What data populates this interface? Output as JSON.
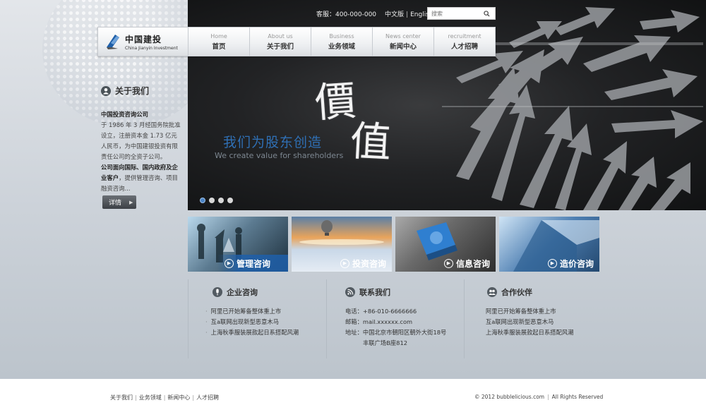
{
  "header": {
    "hotline": "客服：400-000-000",
    "lang_cn": "中文版",
    "lang_en": "English",
    "search_placeholder": "搜索"
  },
  "logo": {
    "cn": "中国建投",
    "en": "China Jianyin Investment"
  },
  "nav": [
    {
      "en": "Home",
      "cn": "首页"
    },
    {
      "en": "About us",
      "cn": "关于我们"
    },
    {
      "en": "Business",
      "cn": "业务领域"
    },
    {
      "en": "News center",
      "cn": "新闻中心"
    },
    {
      "en": "recruitment",
      "cn": "人才招聘"
    }
  ],
  "banner": {
    "cn": "我们为股东创造",
    "en": "We create value for shareholders",
    "calligraphy_1": "價",
    "calligraphy_2": "值",
    "active_slide": 1
  },
  "about": {
    "title": "关于我们",
    "company": "中国投资咨询公司",
    "para1": "于 1986 年 3 月经国务院批准设立，注册资本金 1.73 亿元人民币，为中国建银投资有限责任公司的全资子公司。",
    "bold2": "公司面向国际、国内政府及企业客户",
    "para2": "，提供管理咨询、项目融资咨询...",
    "detail_label": "详情"
  },
  "services": [
    {
      "label": "管理咨询"
    },
    {
      "label": "投资咨询"
    },
    {
      "label": "信息咨询"
    },
    {
      "label": "造价咨询"
    }
  ],
  "columns": {
    "enterprise": {
      "title": "企业咨询",
      "items": [
        "阿里已开始筹备整体重上市",
        "互a联网出现新型恶意木马",
        "上海秋季服装展款起日系搭配风潮"
      ]
    },
    "contact": {
      "title": "联系我们",
      "tel": "电话：+86-010-6666666",
      "email": "邮箱：mail.xxxxxx.com",
      "addr1": "地址：中国北京市朝阳区朝外大街18号",
      "addr2": "丰联广场B座812"
    },
    "partners": {
      "title": "合作伙伴",
      "items": [
        "阿里已开始筹备整体重上市",
        "互a联网出现新型恶意木马",
        "上海秋季服装展款起日系搭配风潮"
      ]
    }
  },
  "footer": {
    "links": [
      "关于我们",
      "业务领域",
      "新闻中心",
      "人才招聘"
    ],
    "copyright": "© 2012 bubblelicious.com",
    "rights": "All Rights Reserved"
  },
  "colors": {
    "accent_blue": "#2f6fb4",
    "dark_banner": "#222325",
    "page_bg": "#ccd2d9"
  }
}
